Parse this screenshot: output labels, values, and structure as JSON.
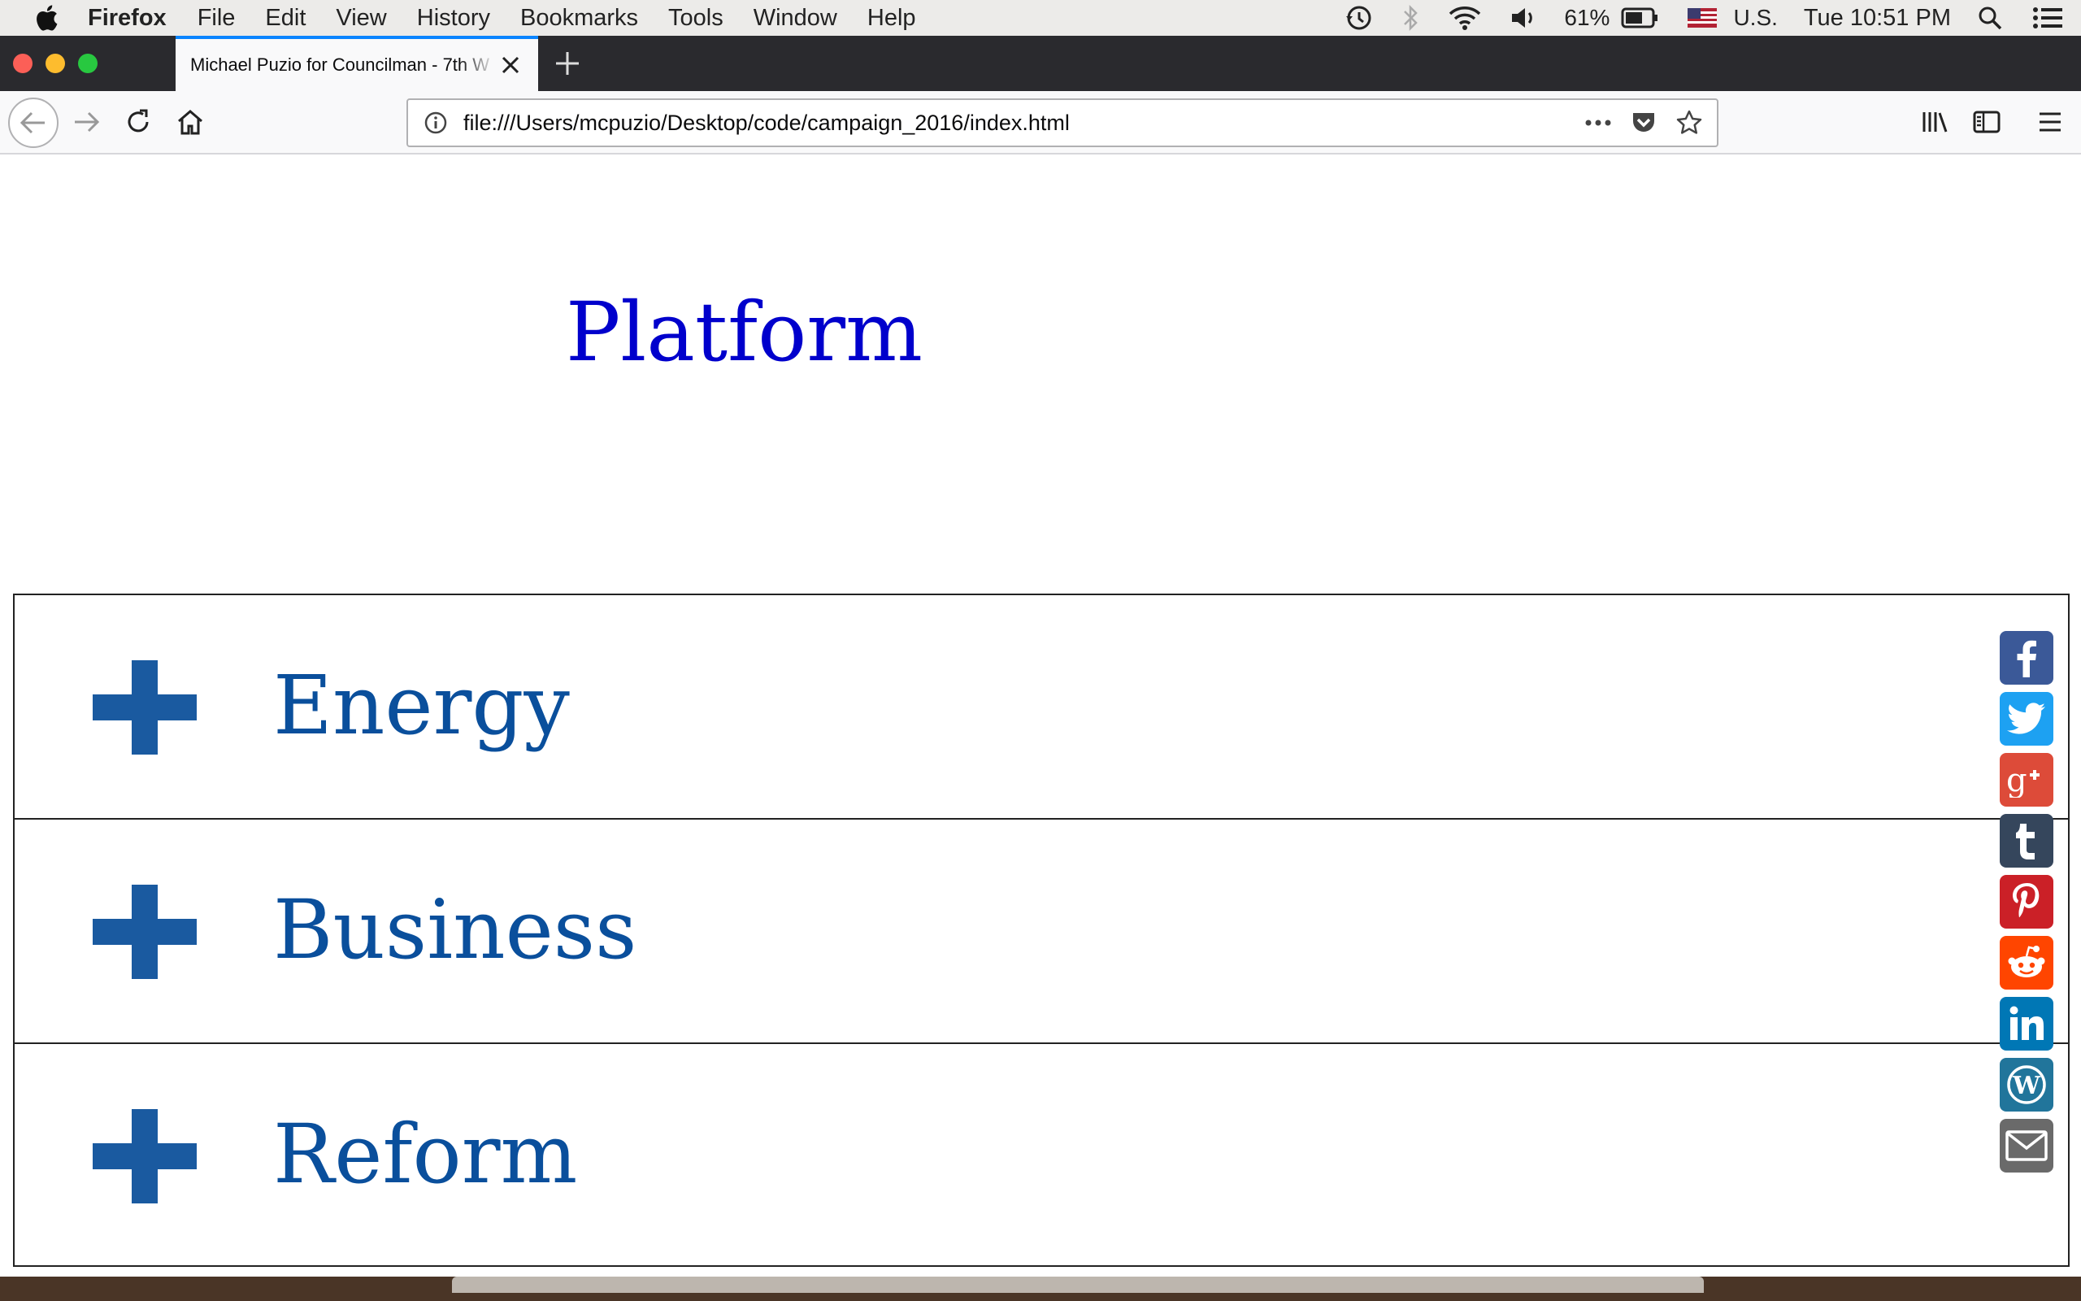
{
  "menubar": {
    "app_name": "Firefox",
    "items": [
      "File",
      "Edit",
      "View",
      "History",
      "Bookmarks",
      "Tools",
      "Window",
      "Help"
    ],
    "battery": "61%",
    "input_source": "U.S.",
    "clock": "Tue 10:51 PM",
    "icons": [
      "apple-icon",
      "time-machine-icon",
      "bluetooth-icon",
      "wifi-icon",
      "volume-icon",
      "battery-icon",
      "flag-icon",
      "spotlight-icon",
      "notification-center-icon"
    ]
  },
  "browser": {
    "tab_title": "Michael Puzio for Councilman - 7th W",
    "url": "file:///Users/mcpuzio/Desktop/code/campaign_2016/index.html",
    "accent_color": "#0a84ff"
  },
  "page": {
    "heading": "Platform",
    "heading_color": "#0000cc",
    "accordion": [
      {
        "label": "Energy"
      },
      {
        "label": "Business"
      },
      {
        "label": "Reform"
      }
    ],
    "accordion_color": "#0a4f9c"
  },
  "share": [
    {
      "name": "facebook",
      "color": "#3b5998"
    },
    {
      "name": "twitter",
      "color": "#1da1f2"
    },
    {
      "name": "google-plus",
      "color": "#dd4b39"
    },
    {
      "name": "tumblr",
      "color": "#35465c"
    },
    {
      "name": "pinterest",
      "color": "#cb2027"
    },
    {
      "name": "reddit",
      "color": "#ff4500"
    },
    {
      "name": "linkedin",
      "color": "#0077b5"
    },
    {
      "name": "wordpress",
      "color": "#21759b"
    },
    {
      "name": "email",
      "color": "#6a6a6a"
    }
  ]
}
